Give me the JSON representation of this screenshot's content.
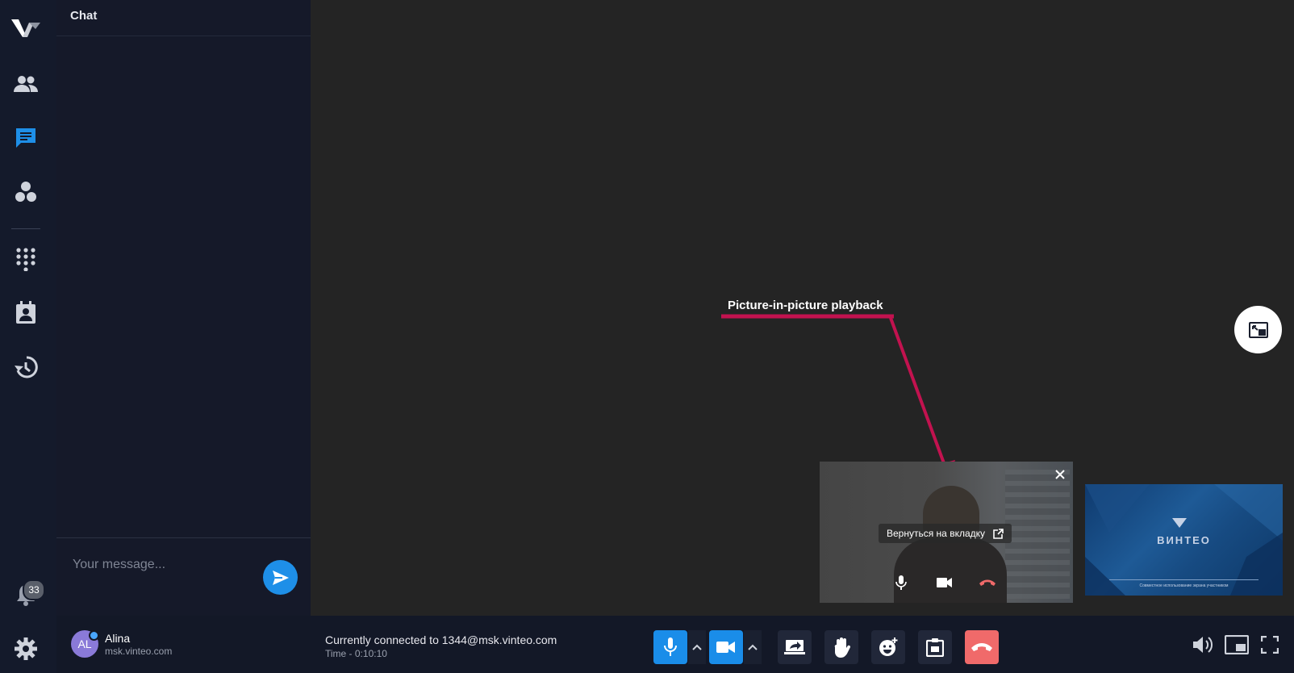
{
  "chat": {
    "title": "Chat",
    "input_placeholder": "Your message..."
  },
  "sidebar": {
    "items": [
      "participants-icon",
      "chat-icon",
      "groups-icon",
      "dialpad-icon",
      "contacts-icon",
      "history-icon"
    ],
    "notifications_count": "33"
  },
  "user": {
    "initials": "AL",
    "name": "Alina",
    "domain": "msk.vinteo.com"
  },
  "connection": {
    "status": "Currently connected to 1344@msk.vinteo.com",
    "time": "Time - 0:10:10"
  },
  "annotation": {
    "label": "Picture-in-picture playback"
  },
  "pip": {
    "return_label": "Вернуться на вкладку"
  },
  "screen_share": {
    "logo_text": "ВИНТЕО",
    "caption": "Совместное использование экрана участником"
  },
  "colors": {
    "accent": "#1a8de9",
    "hangup": "#f06a6a",
    "annotation": "#c2124f",
    "sidebar_bg": "#141a2b"
  }
}
